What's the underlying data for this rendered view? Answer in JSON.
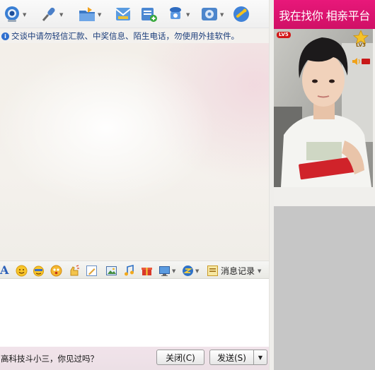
{
  "toolbar": {
    "items": [
      {
        "icon": "video-call-icon",
        "has_caret": true
      },
      {
        "icon": "voice-call-icon",
        "has_caret": true
      },
      {
        "icon": "send-file-icon",
        "has_caret": true
      },
      {
        "icon": "email-icon",
        "has_caret": false
      },
      {
        "icon": "create-group-icon",
        "has_caret": false
      },
      {
        "icon": "app-icon",
        "has_caret": true
      },
      {
        "icon": "settings-icon",
        "has_caret": true
      },
      {
        "icon": "qq-space-icon",
        "has_caret": false
      }
    ]
  },
  "notice": {
    "text": "交谈中请勿轻信汇款、中奖信息、陌生电话，勿使用外挂软件。"
  },
  "input_toolbar": {
    "font_label": "A",
    "items": [
      "emoticon-icon",
      "magic-face-icon",
      "funny-face-icon",
      "nudge-icon",
      "handwriting-icon",
      "image-icon",
      "music-icon",
      "gift-icon",
      "screen-capture-icon",
      "more-icon"
    ],
    "history_label": "消息记录"
  },
  "status": {
    "text": "高科技斗小三，你见过吗？"
  },
  "buttons": {
    "close_label": "关闭(C)",
    "send_label": "发送(S)"
  },
  "right_panel": {
    "ad_text": "我在找你 相亲平台",
    "vip_badge": "LV5",
    "level_badge": "LV3"
  },
  "colors": {
    "ad_banner": "#e8187a",
    "own_photo_placeholder": "#c6c6c6",
    "notice_text": "#1a3c7a"
  }
}
